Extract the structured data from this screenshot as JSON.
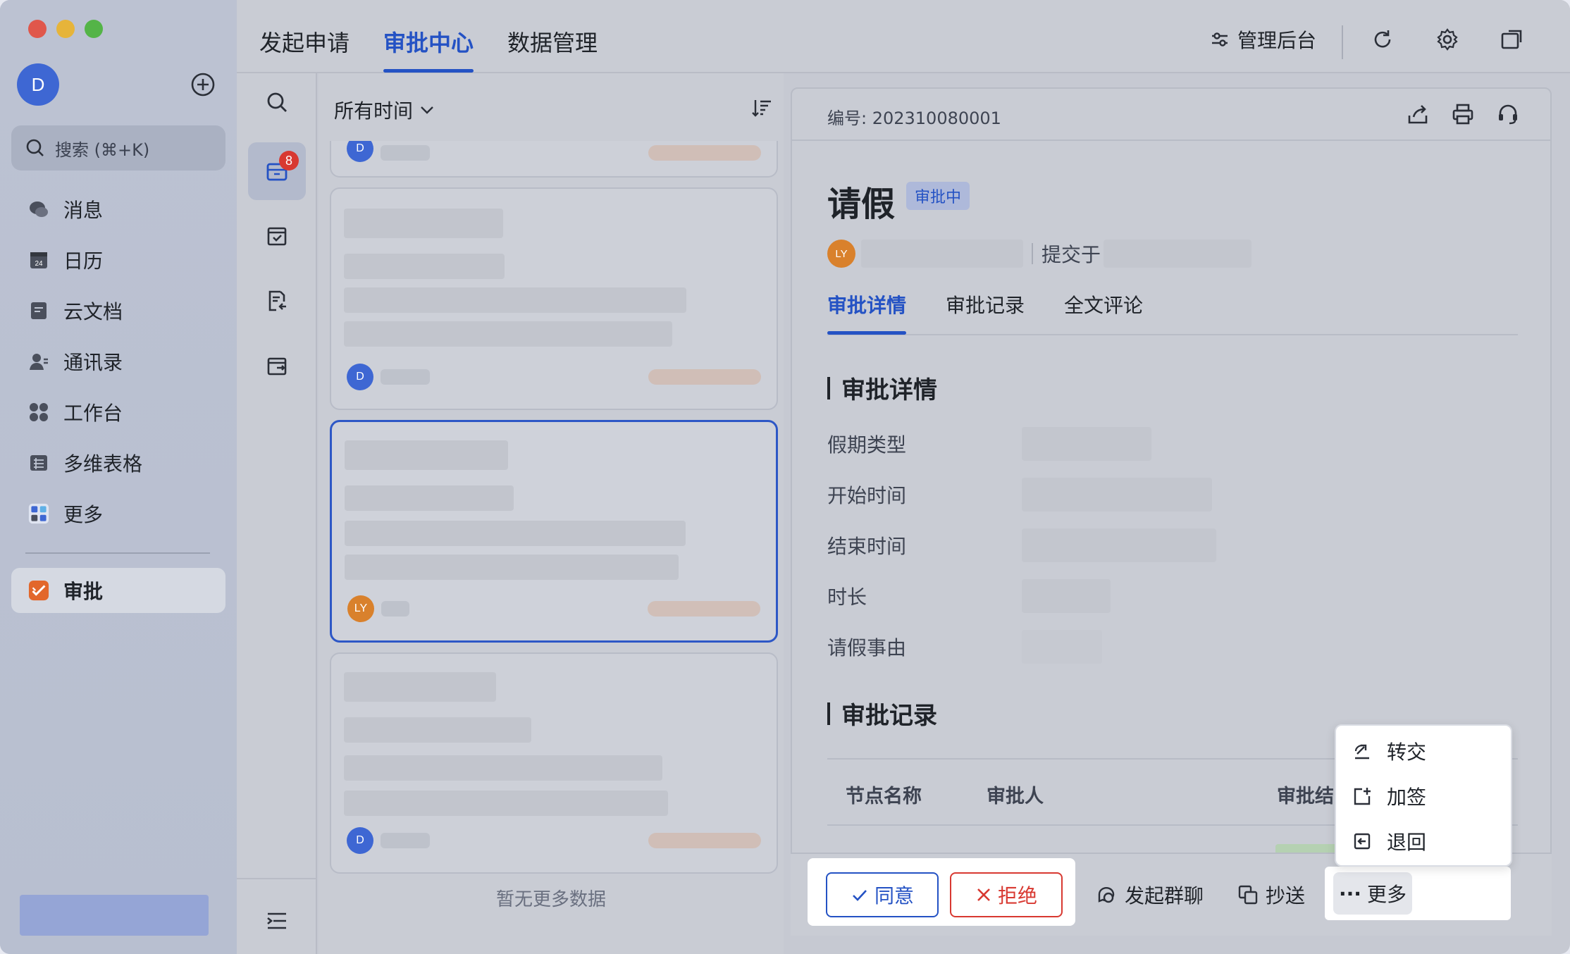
{
  "sidebar": {
    "avatar_letter": "D",
    "search_placeholder": "搜索 (⌘+K)",
    "items": [
      {
        "label": "消息",
        "icon": "chat-icon"
      },
      {
        "label": "日历",
        "icon": "calendar-icon"
      },
      {
        "label": "云文档",
        "icon": "doc-icon"
      },
      {
        "label": "通讯录",
        "icon": "contacts-icon"
      },
      {
        "label": "工作台",
        "icon": "apps-icon"
      },
      {
        "label": "多维表格",
        "icon": "table-icon"
      },
      {
        "label": "更多",
        "icon": "more-apps-icon"
      }
    ],
    "active_item": {
      "label": "审批",
      "icon": "approval-icon"
    }
  },
  "topbar": {
    "tabs": [
      {
        "label": "发起申请"
      },
      {
        "label": "审批中心"
      },
      {
        "label": "数据管理"
      }
    ],
    "active_tab": "审批中心",
    "admin_label": "管理后台"
  },
  "rail": {
    "badge_count": "8"
  },
  "list": {
    "filter_label": "所有时间",
    "cards": [
      {
        "avatar": "D"
      },
      {
        "avatar": "LY"
      },
      {
        "avatar": "D"
      }
    ],
    "top_card_avatar": "D",
    "no_more_text": "暂无更多数据"
  },
  "detail": {
    "number_label": "编号: 202310080001",
    "title": "请假",
    "status": "审批中",
    "submitter_avatar": "LY",
    "submitted_label": "提交于",
    "tabs": [
      "审批详情",
      "审批记录",
      "全文评论"
    ],
    "section_detail": "审批详情",
    "fields": [
      "假期类型",
      "开始时间",
      "结束时间",
      "时长",
      "请假事由"
    ],
    "section_record": "审批记录",
    "table_headers": [
      "节点名称",
      "审批人",
      "审批结"
    ],
    "status_color": "#2452c4"
  },
  "actions": {
    "agree": "同意",
    "reject": "拒绝",
    "group_chat": "发起群聊",
    "cc": "抄送",
    "more": "更多"
  },
  "menu": {
    "items": [
      "转交",
      "加签",
      "退回"
    ]
  }
}
